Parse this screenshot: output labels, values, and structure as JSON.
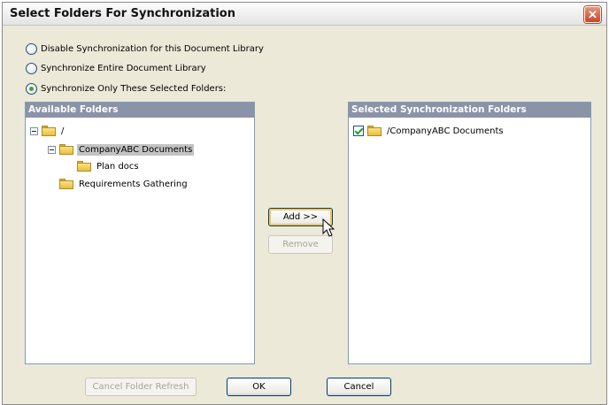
{
  "dialog": {
    "title": "Select Folders For Synchronization",
    "close_glyph": "✕"
  },
  "sync_options": [
    {
      "label": "Disable Synchronization for this Document Library",
      "checked": false
    },
    {
      "label": "Synchronize Entire Document Library",
      "checked": false
    },
    {
      "label": "Synchronize Only These Selected Folders:",
      "checked": true
    }
  ],
  "available_folders": {
    "header": "Available Folders",
    "root_label": "/",
    "items": [
      {
        "label": "CompanyABC Documents",
        "selected": true
      },
      {
        "label": "Plan docs",
        "selected": false
      },
      {
        "label": "Requirements Gathering",
        "selected": false
      }
    ]
  },
  "selected_folders": {
    "header": "Selected Synchronization Folders",
    "items": [
      {
        "label": "/CompanyABC Documents",
        "checked": true
      }
    ]
  },
  "buttons": {
    "add": "Add >>",
    "remove": "Remove",
    "cancel_refresh": "Cancel Folder Refresh",
    "ok": "OK",
    "cancel": "Cancel"
  },
  "icons": {
    "close": "close-icon",
    "folder": "folder-icon",
    "expander": "collapse-icon",
    "cursor": "mouse-pointer-icon"
  },
  "colors": {
    "panel_header": "#8b93a8",
    "selection": "#c3c3c3",
    "close_button": "#c7462a"
  }
}
